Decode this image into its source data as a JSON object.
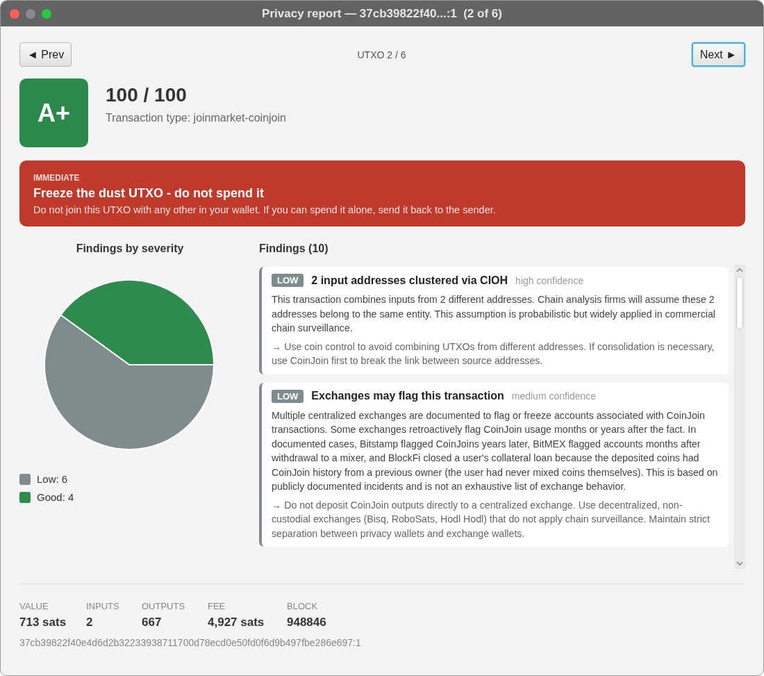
{
  "window": {
    "title": "Privacy report — 37cb39822f40...:1  (2 of 6)"
  },
  "nav": {
    "prev": "◄ Prev",
    "position": "UTXO 2 / 6",
    "next": "Next ►"
  },
  "grade": {
    "letter": "A+",
    "score": "100 / 100",
    "type": "Transaction type: joinmarket-coinjoin"
  },
  "alert": {
    "level": "IMMEDIATE",
    "title": "Freeze the dust UTXO - do not spend it",
    "text": "Do not join this UTXO with any other in your wallet. If you can spend it alone, send it back to the sender."
  },
  "severity_chart": {
    "chart_data": {
      "type": "pie",
      "title": "Findings by severity",
      "categories": [
        "Low: 6",
        "Good: 4"
      ],
      "values": [
        6,
        4
      ],
      "colors": [
        "#7f8c8d",
        "#2e8b4e"
      ]
    }
  },
  "findings": {
    "title": "Findings (10)",
    "items": [
      {
        "severity": "LOW",
        "title": "2 input addresses clustered via CIOH",
        "confidence": "high confidence",
        "description": "This transaction combines inputs from 2 different addresses. Chain analysis firms will assume these 2 addresses belong to the same entity. This assumption is probabilistic but widely applied in commercial chain surveillance.",
        "recommendation": "→ Use coin control to avoid combining UTXOs from different addresses. If consolidation is necessary, use CoinJoin first to break the link between source addresses."
      },
      {
        "severity": "LOW",
        "title": "Exchanges may flag this transaction",
        "confidence": "medium confidence",
        "description": "Multiple centralized exchanges are documented to flag or freeze accounts associated with CoinJoin transactions. Some exchanges retroactively flag CoinJoin usage months or years after the fact. In documented cases, Bitstamp flagged CoinJoins years later, BitMEX flagged accounts months after withdrawal to a mixer, and BlockFi closed a user's collateral loan because the deposited coins had CoinJoin history from a previous owner (the user had never mixed coins themselves). This is based on publicly documented incidents and is not an exhaustive list of exchange behavior.",
        "recommendation": "→ Do not deposit CoinJoin outputs directly to a centralized exchange. Use decentralized, non-custodial exchanges (Bisq, RoboSats, Hodl Hodl) that do not apply chain surveillance. Maintain strict separation between privacy wallets and exchange wallets."
      }
    ]
  },
  "stats": [
    {
      "label": "VALUE",
      "value": "713 sats"
    },
    {
      "label": "INPUTS",
      "value": "2"
    },
    {
      "label": "OUTPUTS",
      "value": "667"
    },
    {
      "label": "FEE",
      "value": "4,927 sats"
    },
    {
      "label": "BLOCK",
      "value": "948846"
    }
  ],
  "txid": "37cb39822f40e4d6d2b32233938711700d78ecd0e50fd0f6d9b497fbe286e697:1"
}
